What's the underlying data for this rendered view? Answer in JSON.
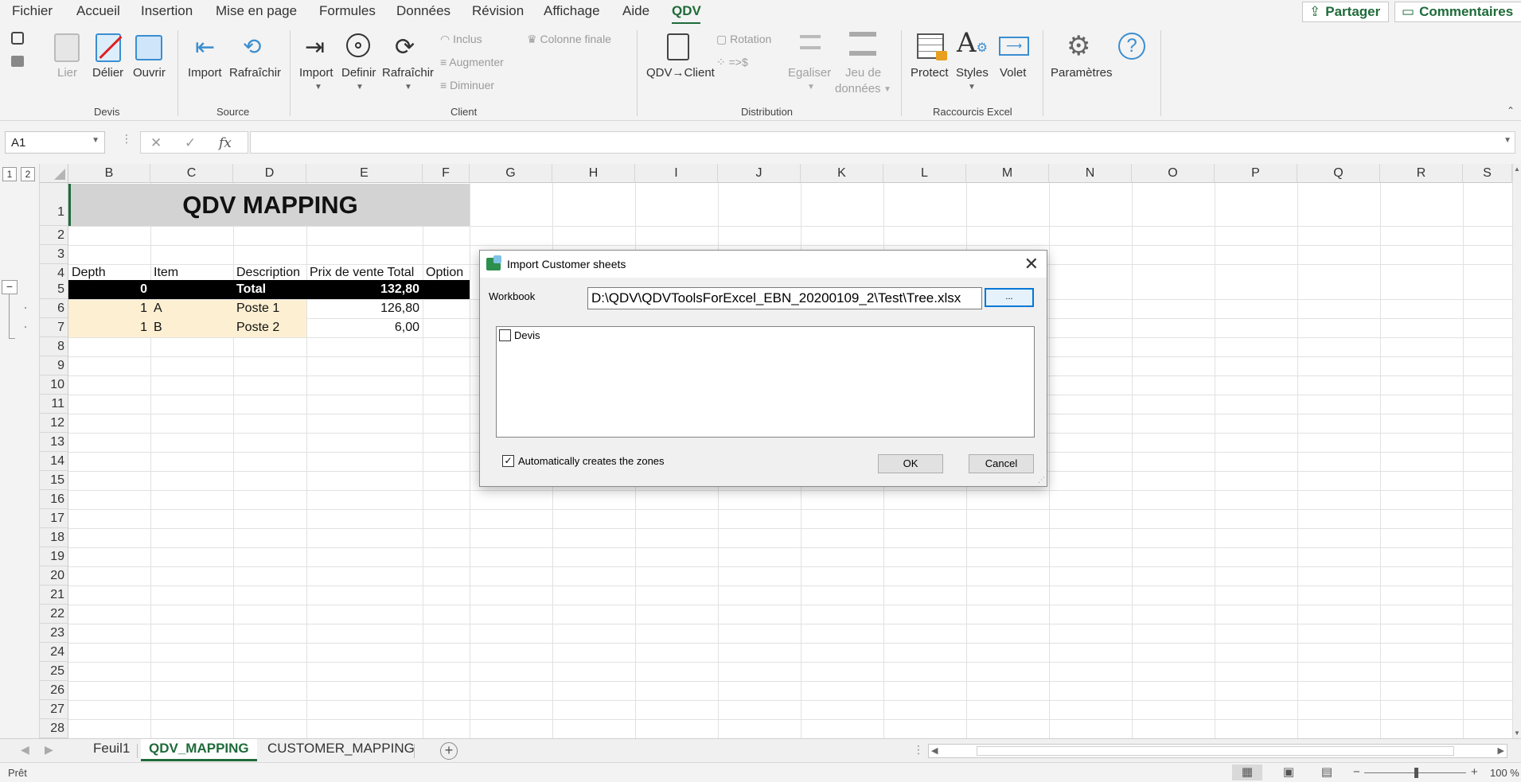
{
  "menu": {
    "items": [
      "Fichier",
      "Accueil",
      "Insertion",
      "Mise en page",
      "Formules",
      "Données",
      "Révision",
      "Affichage",
      "Aide",
      "QDV"
    ],
    "active": "QDV",
    "share_label": "Partager",
    "comments_label": "Commentaires"
  },
  "ribbon": {
    "devis": {
      "lier": "Lier",
      "delier": "Délier",
      "ouvrir": "Ouvrir",
      "group": "Devis"
    },
    "source": {
      "import": "Import",
      "rafraichir": "Rafraîchir",
      "group": "Source"
    },
    "client": {
      "import": "Import",
      "definir": "Definir",
      "rafraichir": "Rafraîchir",
      "inclus": "Inclus",
      "augmenter": "Augmenter",
      "diminuer": "Diminuer",
      "colonne_finale": "Colonne finale",
      "group": "Client"
    },
    "distribution": {
      "qdv_client": "QDV→Client",
      "rotation": "Rotation",
      "arrow": "=>$",
      "egaliser": "Egaliser",
      "jeu_line1": "Jeu de",
      "jeu_line2": "données",
      "group": "Distribution"
    },
    "raccourcis": {
      "protect": "Protect",
      "styles": "Styles",
      "volet": "Volet",
      "group": "Raccourcis Excel"
    },
    "parametres": "Paramètres"
  },
  "formula_bar": {
    "name_box": "A1",
    "formula": ""
  },
  "grid": {
    "columns": [
      "B",
      "C",
      "D",
      "E",
      "F",
      "G",
      "H",
      "I",
      "J",
      "K",
      "L",
      "M",
      "N",
      "O",
      "P",
      "Q",
      "R",
      "S"
    ],
    "rows": [
      "1",
      "2",
      "3",
      "4",
      "5",
      "6",
      "7",
      "8",
      "9",
      "10",
      "11",
      "12",
      "13",
      "14",
      "15",
      "16",
      "17",
      "18",
      "19",
      "20",
      "21",
      "22",
      "23",
      "24",
      "25",
      "26",
      "27",
      "28"
    ],
    "outline_levels": [
      "1",
      "2"
    ],
    "title": "QDV MAPPING",
    "headers": {
      "depth": "Depth",
      "item": "Item",
      "description": "Description",
      "prix": "Prix de vente Total",
      "option": "Option"
    },
    "data_rows": [
      {
        "depth": "0",
        "item": "",
        "description": "Total",
        "prix": "132,80"
      },
      {
        "depth": "1",
        "item": "A",
        "description": "Poste 1",
        "prix": "126,80"
      },
      {
        "depth": "1",
        "item": "B",
        "description": "Poste 2",
        "prix": "6,00"
      }
    ]
  },
  "dialog": {
    "title": "Import Customer sheets",
    "workbook_label": "Workbook",
    "workbook_path": "D:\\QDV\\QDVToolsForExcel_EBN_20200109_2\\Test\\Tree.xlsx",
    "browse_label": "...",
    "sheets": [
      {
        "name": "Devis",
        "checked": false
      }
    ],
    "auto_zones_label": "Automatically creates the zones",
    "auto_zones_checked": true,
    "ok_label": "OK",
    "cancel_label": "Cancel"
  },
  "tabs": {
    "items": [
      "Feuil1",
      "QDV_MAPPING",
      "CUSTOMER_MAPPING"
    ],
    "active": "QDV_MAPPING"
  },
  "status": {
    "text": "Prêt",
    "zoom": "100 %"
  }
}
